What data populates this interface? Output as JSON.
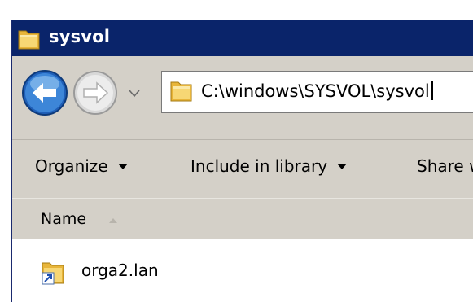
{
  "window": {
    "title": "sysvol"
  },
  "address_bar": {
    "path": "C:\\windows\\SYSVOL\\sysvol"
  },
  "toolbar": {
    "organize_label": "Organize",
    "include_label": "Include in library",
    "share_label": "Share with"
  },
  "column_header": {
    "name_label": "Name"
  },
  "files": [
    {
      "name": "orga2.lan",
      "icon": "folder-shortcut-icon"
    }
  ],
  "colors": {
    "titlebar": "#0a246a",
    "chrome": "#d4d0c8",
    "nav_button": "#3a78c8"
  }
}
